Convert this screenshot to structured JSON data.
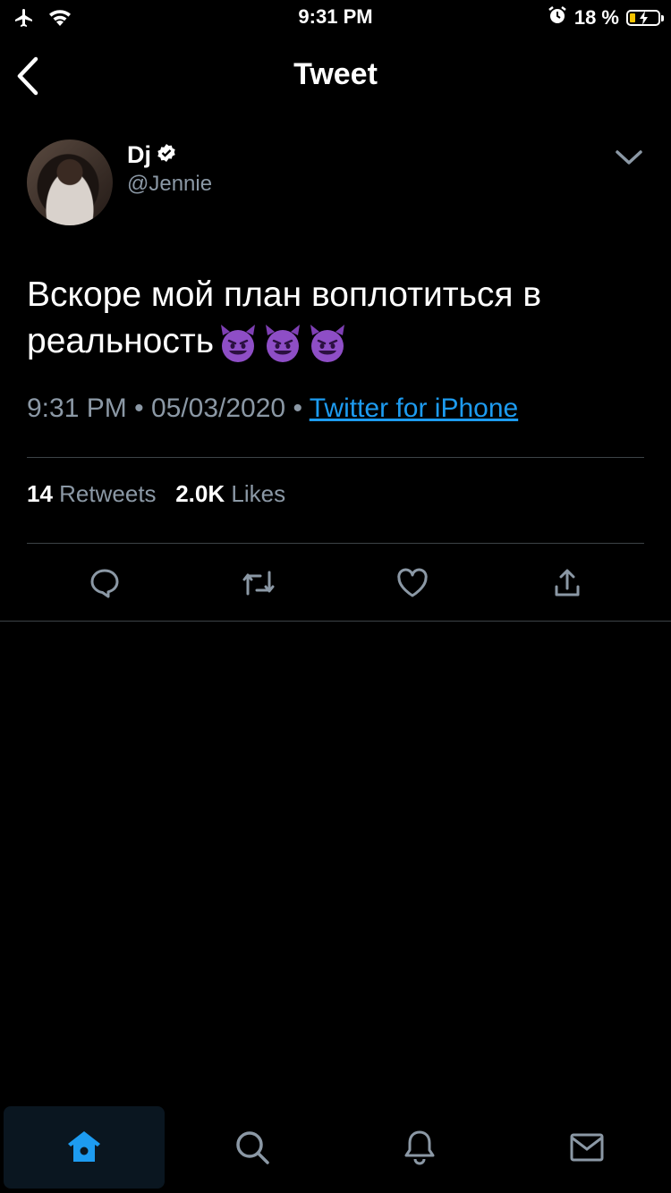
{
  "status_bar": {
    "time": "9:31 PM",
    "battery_percent": "18 %",
    "battery_level": 0.18
  },
  "nav": {
    "title": "Tweet"
  },
  "author": {
    "name": "Dj",
    "handle": "@Jennie",
    "verified": true
  },
  "tweet": {
    "text_line1": "Вскоре мой план воплотиться в",
    "text_line2": "реальность",
    "emojis": [
      "smiling-imp-emoji",
      "smiling-imp-emoji",
      "smiling-imp-emoji"
    ],
    "time": "9:31 PM",
    "date": "05/03/2020",
    "separator": "•",
    "source": "Twitter for iPhone"
  },
  "stats": {
    "retweets_count": "14",
    "retweets_label": "Retweets",
    "likes_count": "2.0K",
    "likes_label": "Likes"
  },
  "actions": [
    "reply-icon",
    "retweet-icon",
    "like-icon",
    "share-icon"
  ],
  "tabbar": [
    "home-icon",
    "search-icon",
    "notifications-icon",
    "messages-icon"
  ],
  "colors": {
    "link": "#1d9bf0",
    "muted": "#8b98a5",
    "battery": "#f5c400"
  }
}
